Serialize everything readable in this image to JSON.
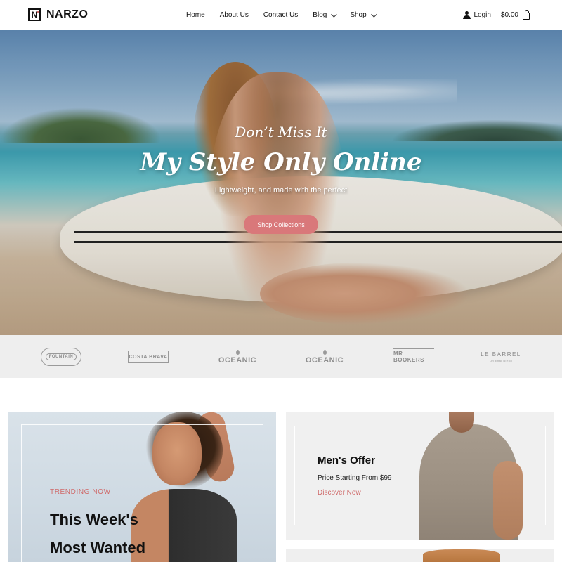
{
  "header": {
    "logo_mark": "N",
    "logo_text": "NARZO",
    "nav": [
      {
        "label": "Home",
        "has_dropdown": false
      },
      {
        "label": "About Us",
        "has_dropdown": false
      },
      {
        "label": "Contact Us",
        "has_dropdown": false
      },
      {
        "label": "Blog",
        "has_dropdown": true
      },
      {
        "label": "Shop",
        "has_dropdown": true
      }
    ],
    "login_label": "Login",
    "cart_total": "$0.00"
  },
  "hero": {
    "pretitle": "Don’t Miss It",
    "title": "My Style Only Online",
    "subtitle": "Lightweight, and made with the perfect",
    "button_label": "Shop Collections"
  },
  "brands": [
    {
      "name": "FOUNTAIN"
    },
    {
      "name": "COSTA BRAVA"
    },
    {
      "name": "OCEANIC"
    },
    {
      "name": "OCEANIC"
    },
    {
      "name": "MR BOOKERS"
    },
    {
      "name": "LE BARREL",
      "tagline": "Original Blend"
    }
  ],
  "promo_left": {
    "eyebrow": "TRENDING NOW",
    "title_line1": "This Week's",
    "title_line2": "Most Wanted"
  },
  "promo_right": {
    "title": "Men's Offer",
    "price_text": "Price Starting From $99",
    "link_label": "Discover Now"
  },
  "colors": {
    "accent": "#d9787a",
    "accent_text": "#cf6b6b",
    "brand_strip_bg": "#eeeeee"
  }
}
